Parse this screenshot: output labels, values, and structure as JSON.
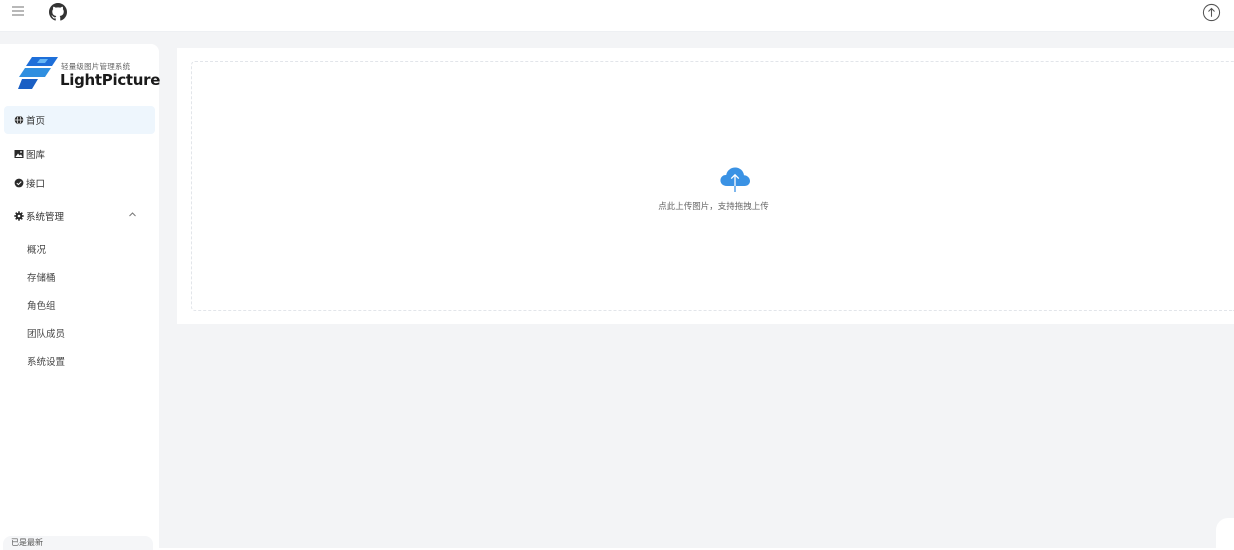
{
  "topbar": {
    "menu_icon": "hamburger-menu-icon",
    "github_icon": "github-icon",
    "upload_icon": "circle-arrow-up-icon"
  },
  "sidebar": {
    "logo": {
      "tagline": "轻量级图片管理系统",
      "brand": "LightPicture"
    },
    "items": [
      {
        "label": "首页",
        "icon": "globe-icon",
        "active": true
      },
      {
        "label": "图库",
        "icon": "image-icon",
        "active": false
      },
      {
        "label": "接口",
        "icon": "check-circle-icon",
        "active": false
      },
      {
        "label": "系统管理",
        "icon": "gear-icon",
        "active": false,
        "expanded": true
      }
    ],
    "sub_items": [
      "概况",
      "存储桶",
      "角色组",
      "团队成员",
      "系统设置"
    ],
    "bottom_label": "已是最新"
  },
  "main": {
    "upload": {
      "hint": "点此上传图片，支持拖拽上传",
      "icon": "cloud-upload-icon"
    }
  },
  "colors": {
    "accent": "#2f8fe0",
    "active_bg": "#eef6fd",
    "page_bg": "#f3f4f6"
  }
}
